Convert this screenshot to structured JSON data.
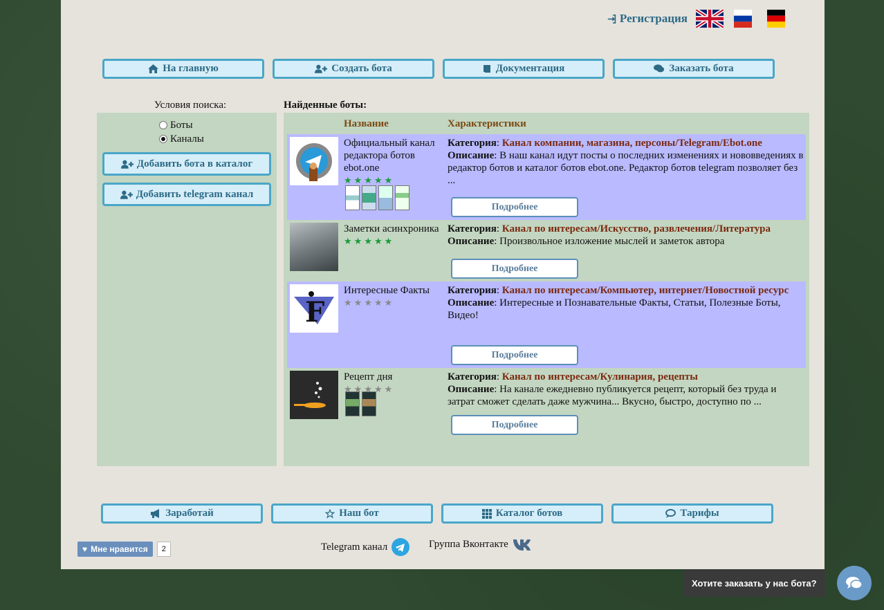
{
  "header": {
    "register_label": "Регистрация",
    "languages": [
      "en-flag-icon",
      "ru-flag-icon",
      "de-flag-icon"
    ]
  },
  "nav_top": [
    {
      "icon": "home-icon",
      "label": "На главную"
    },
    {
      "icon": "user-plus-icon",
      "label": "Создать бота"
    },
    {
      "icon": "book-icon",
      "label": "Документация"
    },
    {
      "icon": "comments-icon",
      "label": "Заказать бота"
    }
  ],
  "sidebar": {
    "title": "Условия поиска:",
    "radio_bots": "Боты",
    "radio_channels": "Каналы",
    "selected": "Каналы",
    "add_bot_label": "Добавить бота в каталог",
    "add_channel_label": "Добавить telegram канал"
  },
  "results": {
    "title": "Найденные боты:",
    "col_name": "Название",
    "col_chars": "Характеристики",
    "category_label": "Категория",
    "description_label": "Описание",
    "more_label": "Подробнее",
    "items": [
      {
        "name": "Официальный канал редактора ботов ebot.one",
        "rating": 5,
        "category": "Канал компании, магазина, персоны/Telegram/Ebot.one",
        "description": "В наш канал идут посты о последних изменениях и нововведениях в редактор ботов и каталог ботов ebot.one. Редактор ботов telegram позволяет без ...",
        "screenshots": 4,
        "highlight": true
      },
      {
        "name": "Заметки асинхроника",
        "rating": 5,
        "category": "Канал по интересам/Искусство, развлечения/Литература",
        "description": "Произвольное изложение мыслей и заметок автора",
        "screenshots": 0,
        "highlight": false
      },
      {
        "name": "Интересные Факты",
        "rating": 0,
        "category": "Канал по интересам/Компьютер, интернет/Новостной ресурс",
        "description": "Интересные и Познавательные Факты, Статьи, Полезные Боты, Видео!",
        "screenshots": 0,
        "highlight": true
      },
      {
        "name": "Рецепт дня",
        "rating": 0,
        "category": "Канал по интересам/Кулинария, рецепты",
        "description": "На канале ежедневно публикуется рецепт, который без труда и затрат сможет сделать даже мужчина... Вкусно, быстро, доступно по ...",
        "screenshots": 2,
        "highlight": false
      }
    ]
  },
  "nav_bottom": [
    {
      "icon": "bullhorn-icon",
      "label": "Заработай"
    },
    {
      "icon": "star-icon",
      "label": "Наш бот"
    },
    {
      "icon": "grid-icon",
      "label": "Каталог ботов"
    },
    {
      "icon": "comment-icon",
      "label": "Тарифы"
    }
  ],
  "footer": {
    "like_label": "Мне нравится",
    "like_count": "2",
    "telegram_label": "Telegram канал",
    "vk_label": "Группа Вконтакте"
  },
  "chat": {
    "prompt": "Хотите заказать у нас бота?"
  },
  "colors": {
    "accent": "#2c6a86",
    "button_border": "#4aa6c8",
    "panel": "#c3d6c1",
    "highlight_row": "#b9baff",
    "category": "#7a2a10",
    "star_on": "#1a9a3a",
    "star_off": "#888888"
  }
}
